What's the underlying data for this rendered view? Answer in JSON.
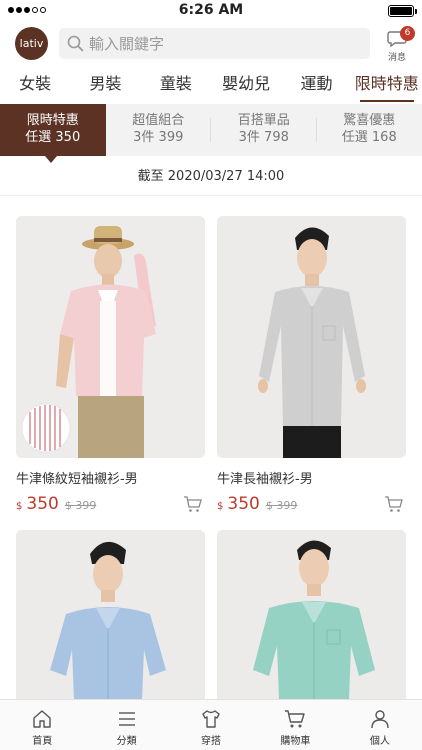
{
  "status": {
    "time": "6:26 AM"
  },
  "header": {
    "logo": "lativ",
    "search_placeholder": "輸入關鍵字",
    "message_badge": "6",
    "message_label": "消息"
  },
  "tabs": [
    "女裝",
    "男裝",
    "童裝",
    "嬰幼兒",
    "運動",
    "限時特惠"
  ],
  "subtabs": [
    {
      "l1": "限時特惠",
      "l2": "任選 350"
    },
    {
      "l1": "超值組合",
      "l2": "3件 399"
    },
    {
      "l1": "百搭單品",
      "l2": "3件 798"
    },
    {
      "l1": "驚喜優惠",
      "l2": "任選 168"
    }
  ],
  "deadline": "截至 2020/03/27 14:00",
  "products": [
    {
      "name": "牛津條紋短袖襯衫-男",
      "currency": "$",
      "price": "350",
      "old_price": "$ 399"
    },
    {
      "name": "牛津長袖襯衫-男",
      "currency": "$",
      "price": "350",
      "old_price": "$ 399"
    }
  ],
  "bottom_nav": [
    "首頁",
    "分類",
    "穿搭",
    "購物車",
    "個人"
  ],
  "colors": {
    "brand": "#5b3224",
    "price": "#c0392b"
  }
}
